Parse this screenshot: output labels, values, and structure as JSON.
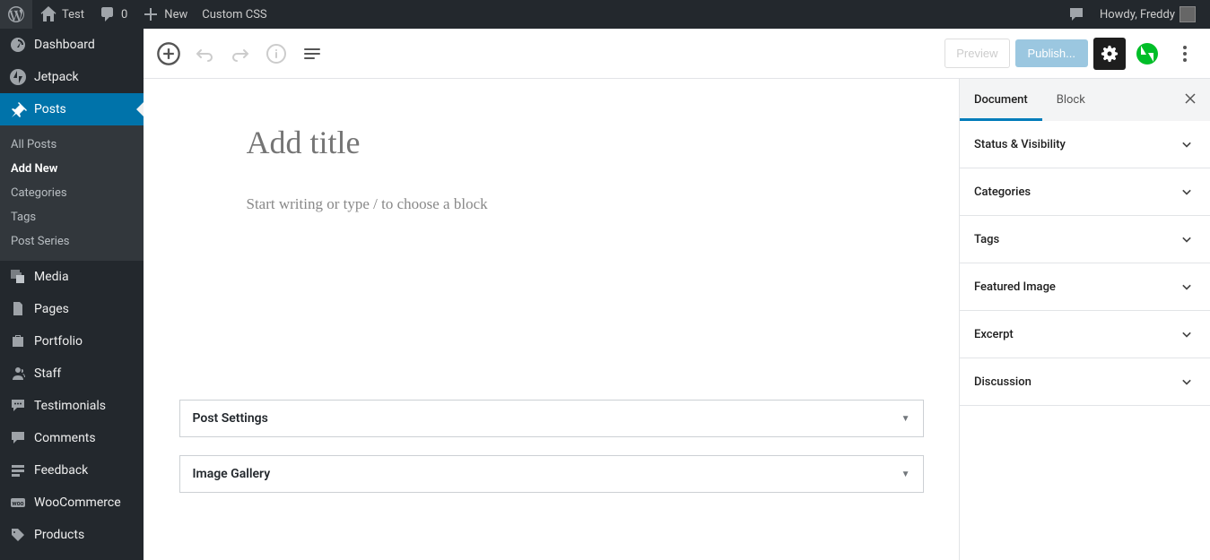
{
  "adminbar": {
    "site_name": "Test",
    "comments_count": "0",
    "new_label": "New",
    "custom_css": "Custom CSS",
    "greeting": "Howdy, Freddy"
  },
  "sidebar": {
    "items": [
      {
        "label": "Dashboard",
        "icon": "dashboard"
      },
      {
        "label": "Jetpack",
        "icon": "jetpack"
      },
      {
        "label": "Posts",
        "icon": "pin"
      },
      {
        "label": "Media",
        "icon": "media"
      },
      {
        "label": "Pages",
        "icon": "pages"
      },
      {
        "label": "Portfolio",
        "icon": "portfolio"
      },
      {
        "label": "Staff",
        "icon": "staff"
      },
      {
        "label": "Testimonials",
        "icon": "testimonials"
      },
      {
        "label": "Comments",
        "icon": "comments"
      },
      {
        "label": "Feedback",
        "icon": "feedback"
      },
      {
        "label": "WooCommerce",
        "icon": "woo"
      },
      {
        "label": "Products",
        "icon": "products"
      }
    ],
    "submenu": [
      {
        "label": "All Posts"
      },
      {
        "label": "Add New"
      },
      {
        "label": "Categories"
      },
      {
        "label": "Tags"
      },
      {
        "label": "Post Series"
      }
    ]
  },
  "editor": {
    "preview": "Preview",
    "publish": "Publish...",
    "title_placeholder": "Add title",
    "body_placeholder": "Start writing or type / to choose a block"
  },
  "metaboxes": [
    {
      "title": "Post Settings"
    },
    {
      "title": "Image Gallery"
    }
  ],
  "settings_panel": {
    "tabs": {
      "document": "Document",
      "block": "Block"
    },
    "sections": [
      {
        "title": "Status & Visibility"
      },
      {
        "title": "Categories"
      },
      {
        "title": "Tags"
      },
      {
        "title": "Featured Image"
      },
      {
        "title": "Excerpt"
      },
      {
        "title": "Discussion"
      }
    ]
  }
}
